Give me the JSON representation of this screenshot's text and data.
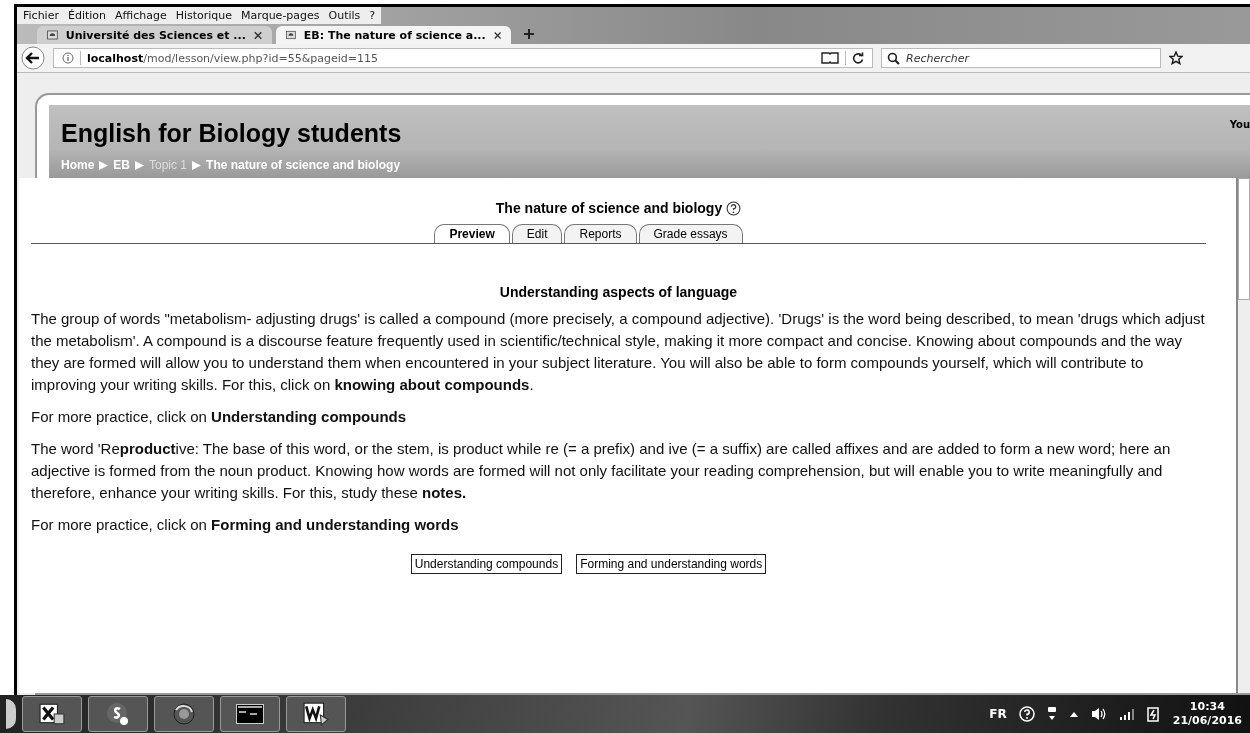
{
  "menu_bar": [
    "Fichier",
    "Édition",
    "Affichage",
    "Historique",
    "Marque-pages",
    "Outils",
    "?"
  ],
  "tabs": [
    {
      "title": "Université des Sciences et ...",
      "selected": false
    },
    {
      "title": "EB: The nature of science a...",
      "selected": true
    }
  ],
  "address_bar": {
    "host": "localhost",
    "path": "/mod/lesson/view.php?id=55&pageid=115"
  },
  "search": {
    "placeholder": "Rechercher"
  },
  "course": {
    "title": "English for Biology students",
    "user_text": "You",
    "breadcrumb": [
      {
        "label": "Home",
        "disabled": false
      },
      {
        "label": "EB",
        "disabled": false
      },
      {
        "label": "Topic 1",
        "disabled": true
      },
      {
        "label": "The nature of science and biology",
        "disabled": false
      }
    ]
  },
  "lesson": {
    "title": "The nature of science and biology",
    "tabs": [
      {
        "label": "Preview",
        "selected": true
      },
      {
        "label": "Edit",
        "selected": false
      },
      {
        "label": "Reports",
        "selected": false
      },
      {
        "label": "Grade essays",
        "selected": false
      }
    ],
    "heading": "Understanding aspects of language",
    "paragraphs": [
      "The group of words \"metabolism- adjusting drugs' is called a compound (more precisely, a compound adjective). 'Drugs' is the word being described, to mean 'drugs which adjust the metabolism'. A compound is a discourse feature frequently used in scientific/technical style, making it more compact and concise. Knowing about compounds and the way they are formed will allow you to understand them when encountered in your subject literature. You will also be able to form compounds yourself, which will contribute to improving your writing skills. For this, click on **knowing about compounds**.",
      "For more practice, click on **Understanding compounds**",
      "The word 'Re**product**ive: The base of this word, or the stem, is product while re (= a prefix) and ive (= a suffix) are called affixes and are added to form a new word; here an adjective is formed from the noun product. Knowing how words are formed will not only facilitate your reading comprehension, but will enable you to write meaningfully and therefore, enhance your writing skills. For this, study these **notes.**",
      "For more practice, click on **Forming and understanding words**"
    ],
    "buttons": [
      "Understanding compounds",
      "Forming and understanding words"
    ]
  },
  "taskbar": {
    "apps": [
      {
        "kind": "spreadsheet"
      },
      {
        "kind": "chat"
      },
      {
        "kind": "browser"
      },
      {
        "kind": "terminal"
      },
      {
        "kind": "document"
      }
    ],
    "language": "FR",
    "time": "10:34",
    "date": "21/06/2016"
  }
}
